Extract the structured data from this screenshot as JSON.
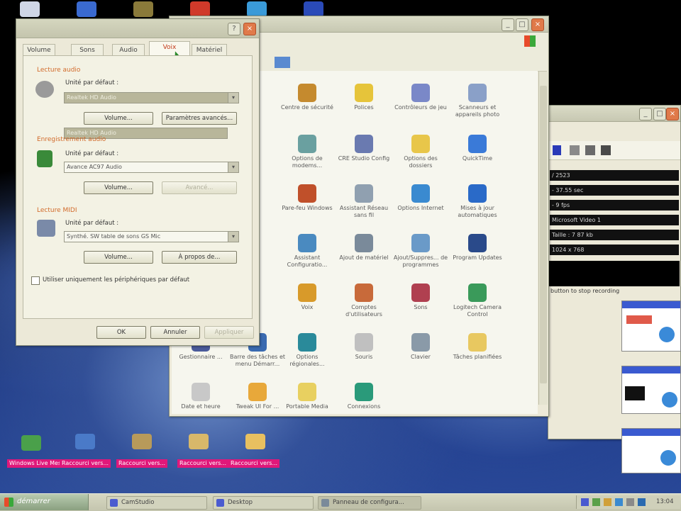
{
  "desktop": {
    "labels": [
      "Windows Live Messenger",
      "Raccourci vers...",
      "Raccourci vers...",
      "Raccourci vers...",
      "Raccourci vers..."
    ]
  },
  "control_panel": {
    "items": [
      {
        "label": "Centre de sécurité",
        "color": "#c58a2e"
      },
      {
        "label": "Polices",
        "color": "#e6c43a"
      },
      {
        "label": "Contrôleurs de jeu",
        "color": "#7a88c8"
      },
      {
        "label": "Scanneurs et appareils photo",
        "color": "#8aa0c8"
      },
      {
        "label": "Options de modems...",
        "color": "#6aa0a0"
      },
      {
        "label": "CRE Studio Config",
        "color": "#6a7ab0"
      },
      {
        "label": "Options des dossiers",
        "color": "#e8c64a"
      },
      {
        "label": "QuickTime",
        "color": "#3a7ad8"
      },
      {
        "label": "Pare-feu Windows",
        "color": "#c0502a"
      },
      {
        "label": "Assistant Réseau sans fil",
        "color": "#90a0b0"
      },
      {
        "label": "Options Internet",
        "color": "#3a8ad0"
      },
      {
        "label": "Mises à jour automatiques",
        "color": "#2a6ac8"
      },
      {
        "label": "Assistant Configuratio...",
        "color": "#4a8ac0"
      },
      {
        "label": "Ajout de matériel",
        "color": "#7a8a9a"
      },
      {
        "label": "Ajout/Suppres... de programmes",
        "color": "#6a9ac8"
      },
      {
        "label": "Program Updates",
        "color": "#2a4a8a"
      },
      {
        "label": "Voix",
        "color": "#d89a2a"
      },
      {
        "label": "Comptes d'utilisateurs",
        "color": "#c86a3a"
      },
      {
        "label": "Sons",
        "color": "#b04050"
      },
      {
        "label": "Logitech Camera Control",
        "color": "#3a9a5a"
      },
      {
        "label": "Options régionales...",
        "color": "#2a8a9a"
      },
      {
        "label": "Souris",
        "color": "#c0c0c0"
      },
      {
        "label": "Clavier",
        "color": "#8a9aa8"
      },
      {
        "label": "Tâches planifiées",
        "color": "#e8c860"
      },
      {
        "label": "Gestionnaire ...",
        "color": "#4a5a9a"
      },
      {
        "label": "Barre des tâches et menu Démarr...",
        "color": "#3a6ab0"
      },
      {
        "label": "Date et heure",
        "color": "#c8c8c8"
      },
      {
        "label": "Tweak UI For ...",
        "color": "#e8a83a"
      },
      {
        "label": "Portable Media",
        "color": "#e8d060"
      },
      {
        "label": "Connexions",
        "color": "#2a9a7a"
      }
    ]
  },
  "dialog": {
    "tabs": [
      "Volume",
      "Sons",
      "Audio",
      "Voix",
      "Matériel"
    ],
    "audio_playback": {
      "group": "Lecture audio",
      "default_label": "Unité par défaut :",
      "device": "Realtek HD Audio",
      "volume_btn": "Volume...",
      "advanced_btn": "Paramètres avancés..."
    },
    "audio_record": {
      "group": "Enregistrement audio",
      "default_label": "Unité par défaut :",
      "device": "Avance AC97 Audio",
      "volume_btn": "Volume...",
      "advanced_btn": "Avancé..."
    },
    "midi": {
      "group": "Lecture MIDI",
      "default_label": "Unité par défaut :",
      "device": "Synthé. SW table de sons GS Mic",
      "volume_btn": "Volume...",
      "about_btn": "À propos de..."
    },
    "checkbox_label": "Utiliser uniquement les périphériques par défaut",
    "ok": "OK",
    "cancel": "Annuler",
    "apply": "Appliquer"
  },
  "right_panel": {
    "rows": [
      "/ 2523",
      "- 37.55 sec",
      "- 9 fps",
      "Microsoft Video 1",
      "Taille : 7 87 kb",
      "1024 x 768"
    ],
    "record_hint": "button to stop recording"
  },
  "taskbar": {
    "start": "démarrer",
    "items": [
      "CamStudio",
      "Desktop",
      "Panneau de configura..."
    ],
    "clock": "13:04"
  }
}
